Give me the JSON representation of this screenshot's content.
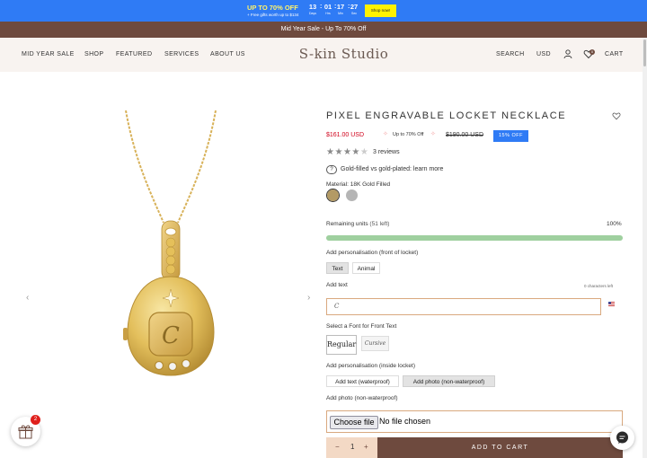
{
  "promo": {
    "headline": "UP TO 70% OFF",
    "subline": "+ Free gifts worth up to $134",
    "countdown": [
      {
        "value": "13",
        "label": "Days"
      },
      {
        "value": "01",
        "label": "Hrs"
      },
      {
        "value": "17",
        "label": "Min"
      },
      {
        "value": "27",
        "label": "Sec"
      }
    ],
    "cta": "Shop now!"
  },
  "announcement": "Mid Year Sale - Up To 70% Off",
  "header": {
    "logo": "S-kin Studio",
    "nav": [
      "MID YEAR SALE",
      "SHOP",
      "FEATURED",
      "SERVICES",
      "ABOUT US"
    ],
    "search": "SEARCH",
    "currency": "USD",
    "cart": "CART",
    "cart_count": "0"
  },
  "product": {
    "title": "PIXEL ENGRAVABLE LOCKET NECKLACE",
    "price": "$161.00 USD",
    "promo_tag": "Up to 70% Off",
    "compare_price": "$190.00 USD",
    "discount_badge": "15% OFF",
    "rating": 4,
    "rating_max": 5,
    "reviews": "3 reviews",
    "info_link": "Gold-filled vs gold-plated: learn more",
    "material_label": "Material: 18K Gold Filled",
    "swatches": [
      {
        "name": "18K Gold Filled",
        "color": "#b39a65",
        "selected": true
      },
      {
        "name": "Silver",
        "color": "#b5b5b5",
        "selected": false
      }
    ],
    "stock_label": "Remaining units",
    "stock_left": "(51 left)",
    "stock_percent_text": "100%",
    "stock_fraction": 1.0,
    "front_label": "Add personalisation (front of locket)",
    "front_options": [
      {
        "label": "Text",
        "selected": true
      },
      {
        "label": "Animal",
        "selected": false
      }
    ],
    "text_label": "Add text",
    "char_counter": "0 characters left",
    "text_value": "C",
    "font_label": "Select a Font for Front Text",
    "font_options": [
      {
        "label": "Regular",
        "selected": true
      },
      {
        "label": "Cursive",
        "selected": false
      }
    ],
    "inside_label": "Add personalisation (inside locket)",
    "inside_options": [
      {
        "label": "Add text (waterproof)",
        "selected": false
      },
      {
        "label": "Add photo (non-waterproof)",
        "selected": true
      }
    ],
    "photo_label": "Add photo (non-waterproof)",
    "file_button": "Choose file",
    "file_status": "No file chosen",
    "quantity": "1",
    "qty_minus": "−",
    "qty_plus": "+",
    "add_to_cart": "ADD TO CART"
  },
  "gift_count": "2",
  "colors": {
    "promo_bg": "#2f7bf5",
    "brand_brown": "#6e4a3e",
    "sale_red": "#d0021b",
    "stock_bar": "#9fd09f",
    "gold": "#e5c05a"
  }
}
